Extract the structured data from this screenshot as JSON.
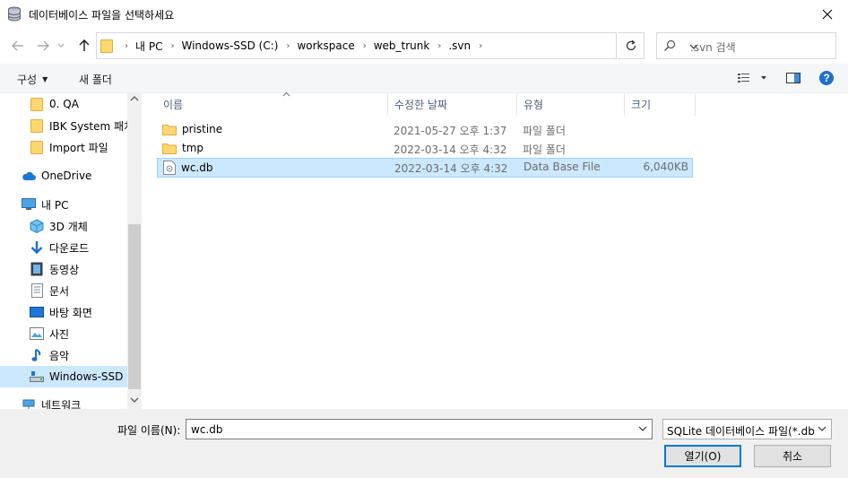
{
  "window": {
    "title": "데이터베이스 파일을 선택하세요",
    "icon": "database-icon"
  },
  "address": {
    "crumbs": [
      "내 PC",
      "Windows-SSD (C:)",
      "workspace",
      "web_trunk",
      ".svn"
    ],
    "search_placeholder": ".svn 검색"
  },
  "commands": {
    "organize": "구성",
    "new_folder": "새 폴더"
  },
  "navpane": {
    "items": [
      {
        "label": "0. QA",
        "icon": "folder-icon"
      },
      {
        "label": "IBK System 패치",
        "icon": "folder-icon"
      },
      {
        "label": "Import 파일",
        "icon": "folder-icon"
      },
      {
        "label": "OneDrive",
        "icon": "cloud-icon"
      },
      {
        "label": "내 PC",
        "icon": "computer-icon"
      },
      {
        "label": "3D 개체",
        "icon": "cube-icon"
      },
      {
        "label": "다운로드",
        "icon": "download-icon"
      },
      {
        "label": "동영상",
        "icon": "video-icon"
      },
      {
        "label": "문서",
        "icon": "document-icon"
      },
      {
        "label": "바탕 화면",
        "icon": "desktop-icon"
      },
      {
        "label": "사진",
        "icon": "picture-icon"
      },
      {
        "label": "음악",
        "icon": "music-icon"
      },
      {
        "label": "Windows-SSD (C:)",
        "icon": "drive-icon"
      },
      {
        "label": "네트워크",
        "icon": "network-icon"
      }
    ]
  },
  "columns": {
    "name": "이름",
    "date": "수정한 날짜",
    "type": "유형",
    "size": "크기"
  },
  "files": [
    {
      "name": "pristine",
      "date": "2021-05-27 오후 1:37",
      "type": "파일 폴더",
      "size": "",
      "icon": "folder-icon"
    },
    {
      "name": "tmp",
      "date": "2022-03-14 오후 4:32",
      "type": "파일 폴더",
      "size": "",
      "icon": "folder-icon"
    },
    {
      "name": "wc.db",
      "date": "2022-03-14 오후 4:32",
      "type": "Data Base File",
      "size": "6,040KB",
      "icon": "database-file-icon",
      "selected": true
    }
  ],
  "bottom": {
    "filename_label": "파일 이름(N):",
    "filename_value": "wc.db",
    "filter_value": "SQLite 데이터베이스 파일(*.db",
    "open_label": "열기(O)",
    "cancel_label": "취소"
  },
  "colors": {
    "selection": "#cce8ff",
    "selection_border": "#99d1ff",
    "accent": "#0078d7",
    "folder": "#ffd76e"
  }
}
